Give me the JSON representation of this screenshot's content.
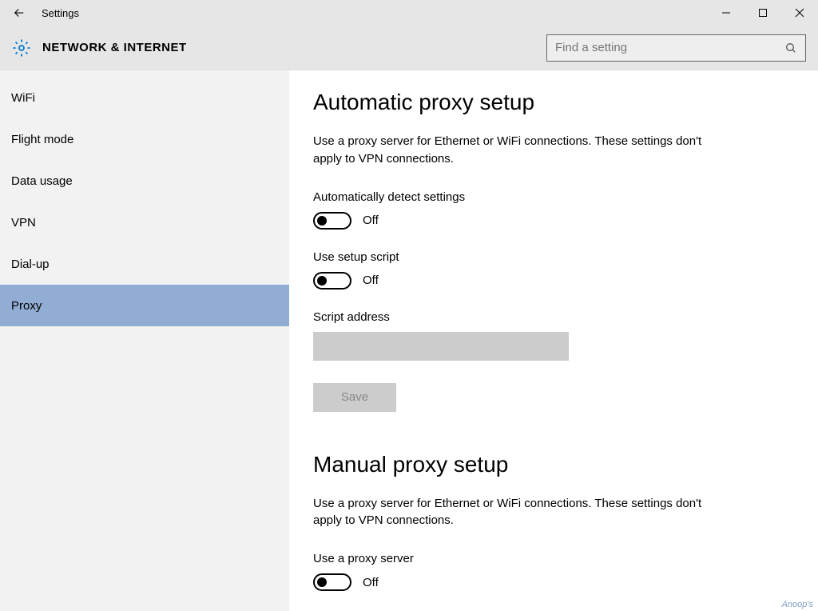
{
  "window": {
    "title": "Settings"
  },
  "header": {
    "title": "NETWORK & INTERNET",
    "search_placeholder": "Find a setting"
  },
  "sidebar": {
    "items": [
      {
        "label": "WiFi",
        "selected": false
      },
      {
        "label": "Flight mode",
        "selected": false
      },
      {
        "label": "Data usage",
        "selected": false
      },
      {
        "label": "VPN",
        "selected": false
      },
      {
        "label": "Dial-up",
        "selected": false
      },
      {
        "label": "Proxy",
        "selected": true
      }
    ]
  },
  "main": {
    "automatic": {
      "heading": "Automatic proxy setup",
      "description": "Use a proxy server for Ethernet or WiFi connections. These settings don't apply to VPN connections.",
      "auto_detect_label": "Automatically detect settings",
      "auto_detect_state": "Off",
      "use_script_label": "Use setup script",
      "use_script_state": "Off",
      "script_address_label": "Script address",
      "script_address_value": "",
      "save_label": "Save"
    },
    "manual": {
      "heading": "Manual proxy setup",
      "description": "Use a proxy server for Ethernet or WiFi connections. These settings don't apply to VPN connections.",
      "use_proxy_label": "Use a proxy server",
      "use_proxy_state": "Off"
    }
  },
  "watermark": "Anoop's"
}
